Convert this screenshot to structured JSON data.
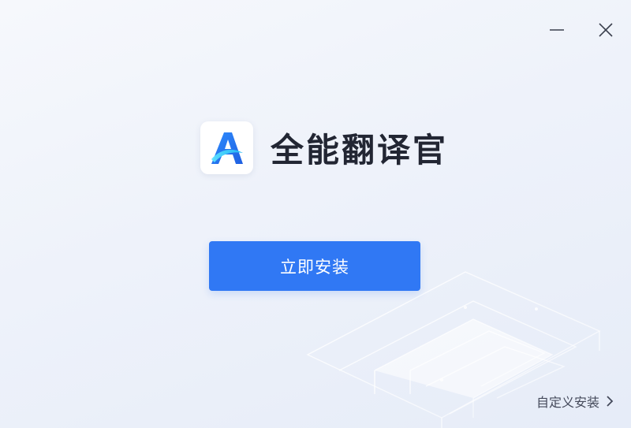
{
  "app": {
    "name": "全能翻译官",
    "logo_icon": "translator-a-logo-icon",
    "accent_color": "#3078f4"
  },
  "window_controls": {
    "minimize_icon": "minimize-icon",
    "close_icon": "close-icon"
  },
  "actions": {
    "install_label": "立即安装",
    "custom_install_label": "自定义安装",
    "custom_install_icon": "chevron-right-icon"
  }
}
